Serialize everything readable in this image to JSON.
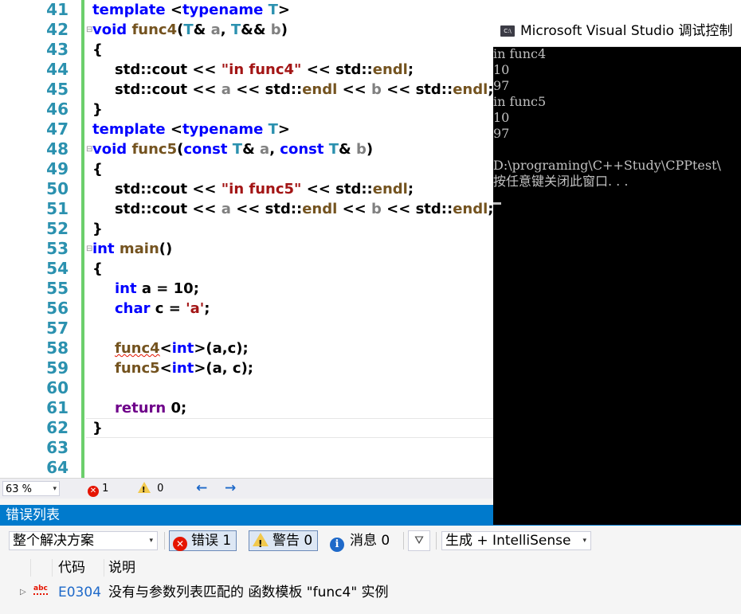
{
  "editor": {
    "line_numbers": [
      "41",
      "42",
      "43",
      "44",
      "45",
      "46",
      "47",
      "48",
      "49",
      "50",
      "51",
      "52",
      "53",
      "54",
      "55",
      "56",
      "57",
      "58",
      "59",
      "60",
      "61",
      "62",
      "63",
      "64"
    ]
  },
  "status": {
    "zoom": "63 %",
    "error_count": "1",
    "warning_count": "0"
  },
  "error_list": {
    "title": "错误列表",
    "scope": "整个解决方案",
    "errors_filter": "错误 1",
    "warnings_filter": "警告 0",
    "messages_filter": "消息 0",
    "build_source": "生成 + IntelliSense",
    "columns": {
      "code": "代码",
      "description": "说明"
    },
    "rows": [
      {
        "code": "E0304",
        "description": "没有与参数列表匹配的 函数模板 \"func4\" 实例"
      }
    ]
  },
  "console": {
    "title": "Microsoft Visual Studio 调试控制",
    "icon_text": "C:\\",
    "lines": [
      "in func4",
      "10",
      "97",
      "in func5",
      "10",
      "97",
      "",
      "D:\\programing\\C++Study\\CPPtest\\",
      "按任意键关闭此窗口. . ."
    ]
  },
  "colors": {
    "keyword": "#0000ff",
    "type": "#2b91af",
    "string": "#a31515",
    "function": "#74531f",
    "accent": "#007acc",
    "error": "#e51400"
  }
}
